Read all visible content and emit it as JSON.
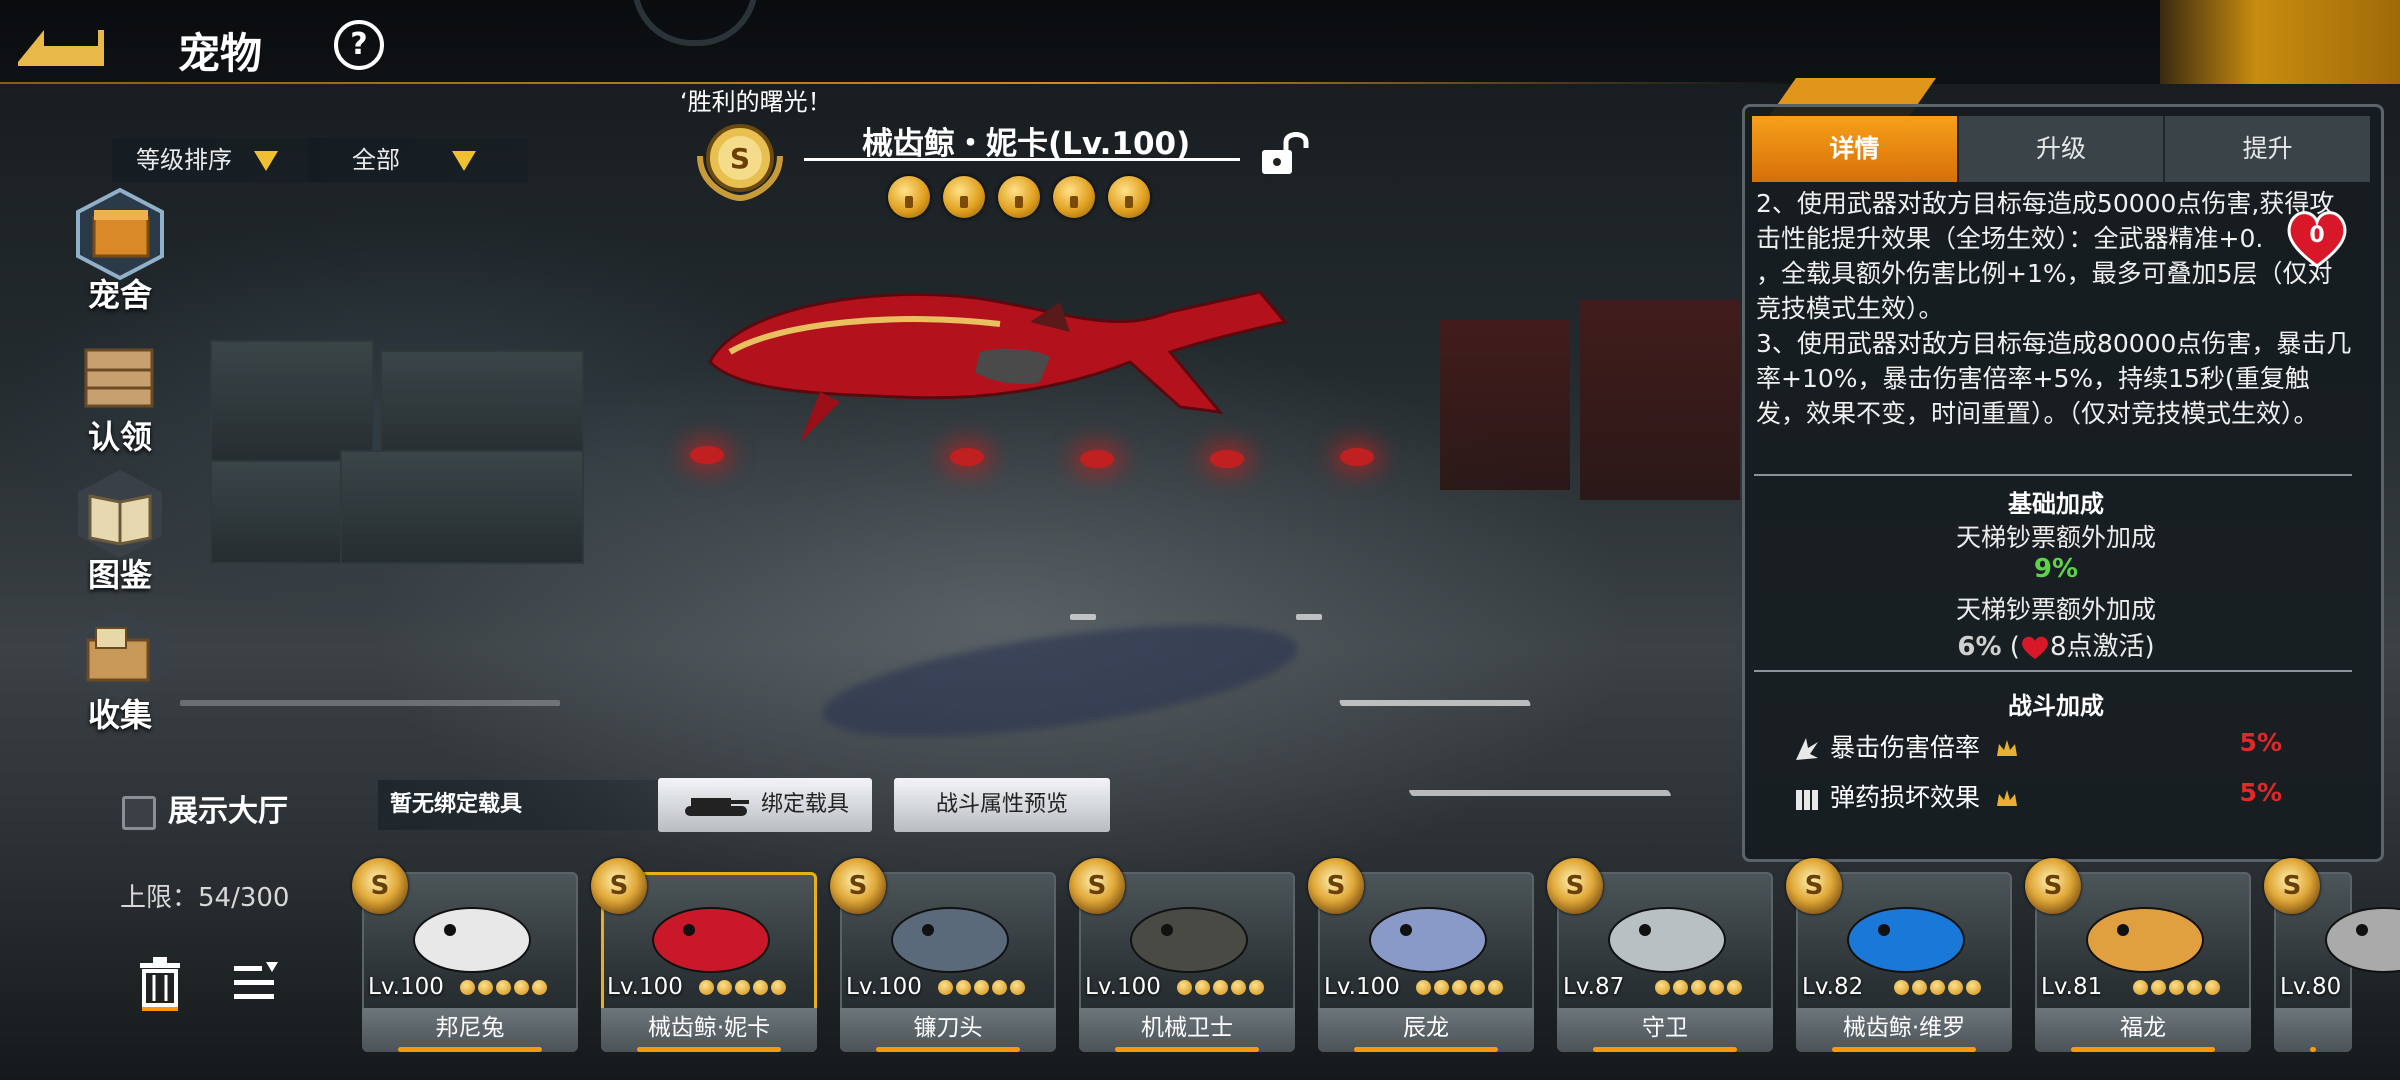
{
  "header": {
    "title": "宠物",
    "help_symbol": "?"
  },
  "filters": {
    "sort_label": "等级排序",
    "category_label": "全部"
  },
  "left_nav": [
    {
      "label": "宠舍",
      "icon": "kennel-icon"
    },
    {
      "label": "认领",
      "icon": "crate-icon"
    },
    {
      "label": "图鉴",
      "icon": "book-icon"
    },
    {
      "label": "收集",
      "icon": "collection-box-icon"
    }
  ],
  "show_hall": {
    "label": "展示大厅",
    "checked": false
  },
  "limit_text": "上限：54/300",
  "pet": {
    "banner_text": "‘胜利的曙光！",
    "name": "械齿鲸・妮卡(Lv.100)",
    "medal_letter": "S",
    "star_count": 5
  },
  "binding": {
    "status": "暂无绑定载具",
    "bind_button": "绑定载具",
    "preview_button": "战斗属性预览"
  },
  "panel": {
    "tabs": [
      "详情",
      "升级",
      "提升"
    ],
    "active_tab": 0,
    "description": [
      "2、使用武器对敌方目标每造成50000点伤害,获得攻击性能提升效果（全场生效）：全武器精准+0.",
      "，全载具额外伤害比例+1%，最多可叠加5层（仅对竞技模式生效）。",
      "3、使用武器对敌方目标每造成80000点伤害，暴击几率+10%，暴击伤害倍率+5%，持续15秒(重复触发，效果不变，时间重置）。（仅对竞技模式生效）。"
    ],
    "heart_count": "0",
    "base_bonus": {
      "title": "基础加成",
      "line1_label": "天梯钞票额外加成",
      "line1_value": "9%",
      "line2_label": "天梯钞票额外加成",
      "line2_value": "6%",
      "line2_suffix_open": "(",
      "line2_activate": "8点激活)"
    },
    "battle_bonus": {
      "title": "战斗加成",
      "stats": [
        {
          "label": "暴击伤害倍率",
          "value": "5%",
          "icon": "crit-icon"
        },
        {
          "label": "弹药损坏效果",
          "value": "5%",
          "icon": "ammo-icon"
        }
      ]
    }
  },
  "pets": [
    {
      "name": "邦尼兔",
      "level": "Lv.100",
      "art": "rabbit-icon",
      "color": "#e8e8e8"
    },
    {
      "name": "械齿鲸·妮卡",
      "level": "Lv.100",
      "art": "red-whale-icon",
      "color": "#c8182a",
      "selected": true
    },
    {
      "name": "镰刀头",
      "level": "Lv.100",
      "art": "shark-icon",
      "color": "#5a6a7a"
    },
    {
      "name": "机械卫士",
      "level": "Lv.100",
      "art": "mech-spider-icon",
      "color": "#4a4a44"
    },
    {
      "name": "辰龙",
      "level": "Lv.100",
      "art": "dragon-icon",
      "color": "#8a9ac8"
    },
    {
      "name": "守卫",
      "level": "Lv.87",
      "art": "robot-ball-icon",
      "color": "#b8c0c4"
    },
    {
      "name": "械齿鲸·维罗",
      "level": "Lv.82",
      "art": "blue-whale-icon",
      "color": "#1a78d8"
    },
    {
      "name": "福龙",
      "level": "Lv.81",
      "art": "golden-dragon-icon",
      "color": "#e0a040"
    },
    {
      "name": "",
      "level": "Lv.80",
      "art": "partial-pet-icon",
      "color": "#aaaaaa"
    }
  ]
}
